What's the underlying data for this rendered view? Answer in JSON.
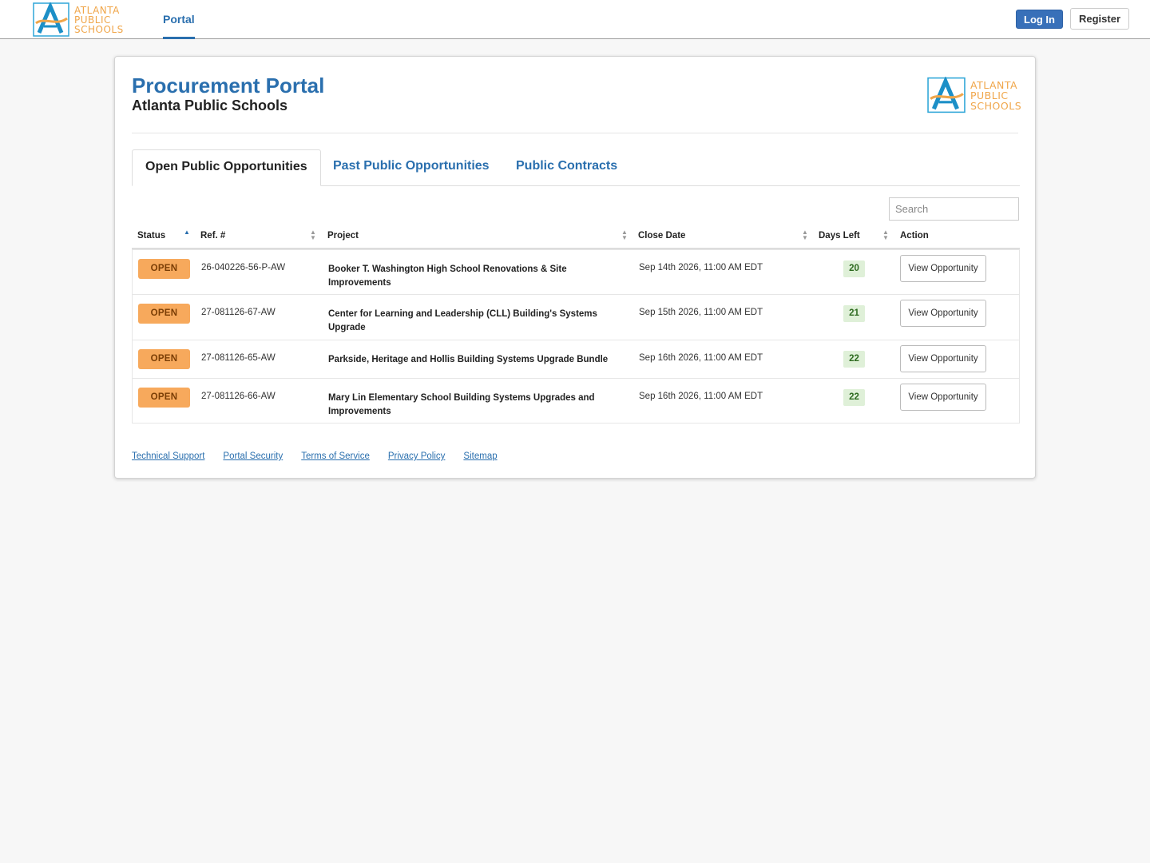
{
  "navbar": {
    "logo_lines": [
      "ATLANTA",
      "PUBLIC",
      "SCHOOLS"
    ],
    "tab": "Portal",
    "login_label": "Log In",
    "register_label": "Register"
  },
  "header": {
    "title": "Procurement Portal",
    "subtitle": "Atlanta Public Schools",
    "logo_lines": [
      "ATLANTA",
      "PUBLIC",
      "SCHOOLS"
    ]
  },
  "tabs": [
    "Open Public Opportunities",
    "Past Public Opportunities",
    "Public Contracts"
  ],
  "active_tab": "Open Public Opportunities",
  "search": {
    "placeholder": "Search"
  },
  "table": {
    "columns": [
      "Status",
      "Ref. #",
      "Project",
      "Close Date",
      "Days Left",
      "Action"
    ],
    "rows": [
      {
        "status": "OPEN",
        "ref": "26-040226-56-P-AW",
        "project": "Booker T. Washington High School Renovations & Site Improvements",
        "close_date": "Sep 14th 2026, 11:00 AM EDT",
        "days_left": "20",
        "action": "View Opportunity"
      },
      {
        "status": "OPEN",
        "ref": "27-081126-67-AW",
        "project": "Center for Learning and Leadership (CLL) Building's Systems Upgrade",
        "close_date": "Sep 15th 2026, 11:00 AM EDT",
        "days_left": "21",
        "action": "View Opportunity"
      },
      {
        "status": "OPEN",
        "ref": "27-081126-65-AW",
        "project": "Parkside, Heritage and Hollis Building Systems Upgrade Bundle",
        "close_date": "Sep 16th 2026, 11:00 AM EDT",
        "days_left": "22",
        "action": "View Opportunity"
      },
      {
        "status": "OPEN",
        "ref": "27-081126-66-AW",
        "project": "Mary Lin Elementary School Building Systems Upgrades and Improvements",
        "close_date": "Sep 16th 2026, 11:00 AM EDT",
        "days_left": "22",
        "action": "View Opportunity"
      }
    ]
  },
  "footer_links": [
    "Technical Support",
    "Portal Security",
    "Terms of Service",
    "Privacy Policy",
    "Sitemap"
  ],
  "colors": {
    "brand_blue": "#2a6fae",
    "login_button": "#3870b9",
    "open_badge": "#f7a95c",
    "days_badge": "#dff0d8",
    "logo_orange": "#f0a64a",
    "logo_cyan": "#2fa6d8"
  }
}
